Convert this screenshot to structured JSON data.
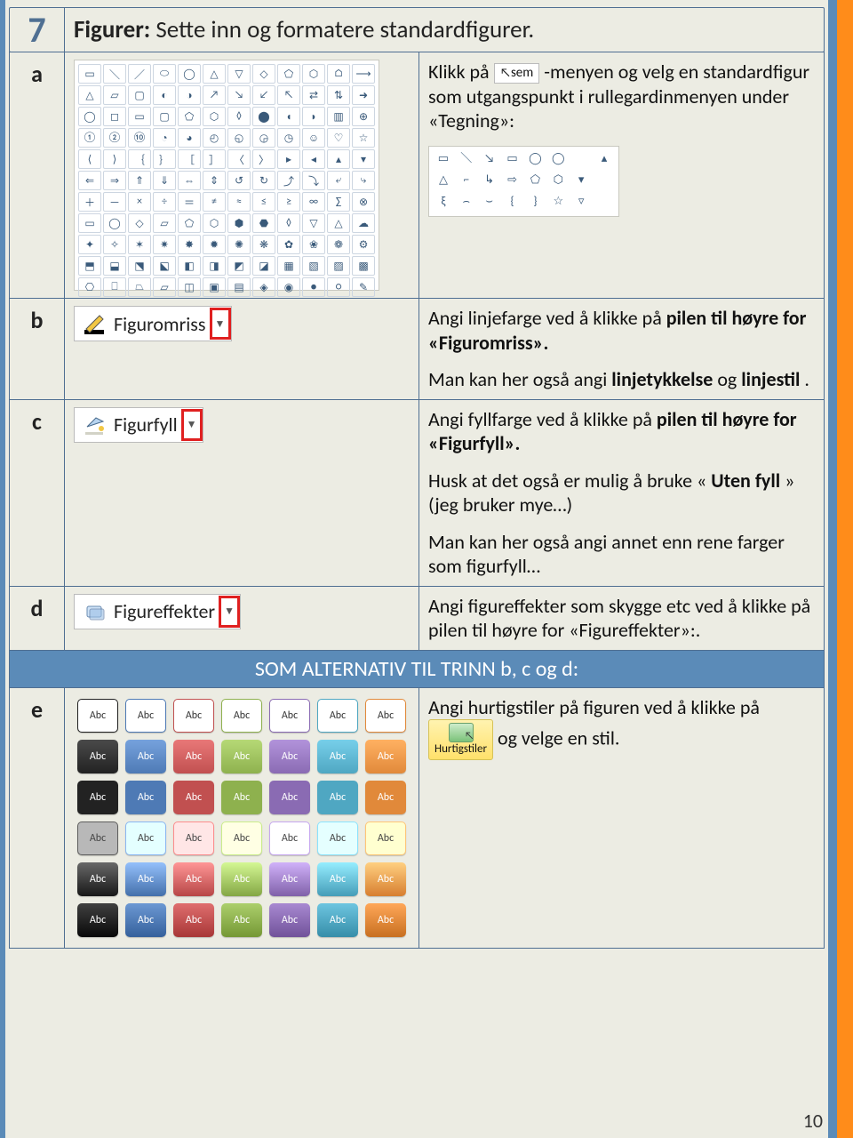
{
  "section_number": "7",
  "title_bold": "Figurer:",
  "title_rest": " Sette inn og formatere standardfigurer.",
  "rows": {
    "a": {
      "letter": "a",
      "text1": "Klikk på ",
      "chip_label": "sem",
      "text2": "-menyen og velg en standardfigur som utgangspunkt i rullegardinmenyen under «Tegning»:"
    },
    "b": {
      "letter": "b",
      "btn_label": "Figuromriss",
      "p1_pre": "Angi linjefarge ved å klikke på ",
      "p1_b1": "pilen til høyre for «Figuromriss».",
      "p2_pre": "Man kan her også angi ",
      "p2_b1": "linjetykkelse",
      "p2_mid": " og ",
      "p2_b2": "linjestil",
      "p2_post": "."
    },
    "c": {
      "letter": "c",
      "btn_label": "Figurfyll",
      "p1_pre": "Angi fyllfarge ved å klikke på ",
      "p1_b1": "pilen til høyre for «Figurfyll».",
      "p2_pre": "Husk at det også er mulig å bruke «",
      "p2_b1": "Uten fyll",
      "p2_post": "» (jeg bruker mye…)",
      "p3": "Man kan her også angi annet enn rene farger som figurfyll…"
    },
    "d": {
      "letter": "d",
      "btn_label": "Figureffekter",
      "p1": "Angi figureffekter som skygge etc ved å klikke på pilen til høyre for «Figureffekter»:."
    },
    "e": {
      "letter": "e",
      "p1_pre": "Angi hurtigstiler på figuren ved å klikke på ",
      "hurtig_label": "Hurtigstiler",
      "p1_post": " og velge en stil."
    }
  },
  "alt_banner": "SOM ALTERNATIV TIL TRINN b, c og d:",
  "qstyle_label": "Abc",
  "qstyle_colors": [
    "#222222",
    "#4e7ab5",
    "#c15050",
    "#8eb14e",
    "#8a6bb3",
    "#4fa7c2",
    "#e1893a"
  ],
  "page_number": "10",
  "icons": {
    "outline": "pencil-outline-icon",
    "fill": "paint-bucket-icon",
    "effects": "effects-icon",
    "cursor": "cursor-icon"
  },
  "mini_shapes": [
    "▭",
    "＼",
    "↘",
    "▭",
    "◯",
    "◯",
    "",
    "",
    "△",
    "⌐",
    "↳",
    "⇨",
    "⬠",
    "⬡",
    "▾",
    "",
    "ξ",
    "⌢",
    "⌣",
    "{",
    "}",
    "☆",
    "▿",
    ""
  ]
}
